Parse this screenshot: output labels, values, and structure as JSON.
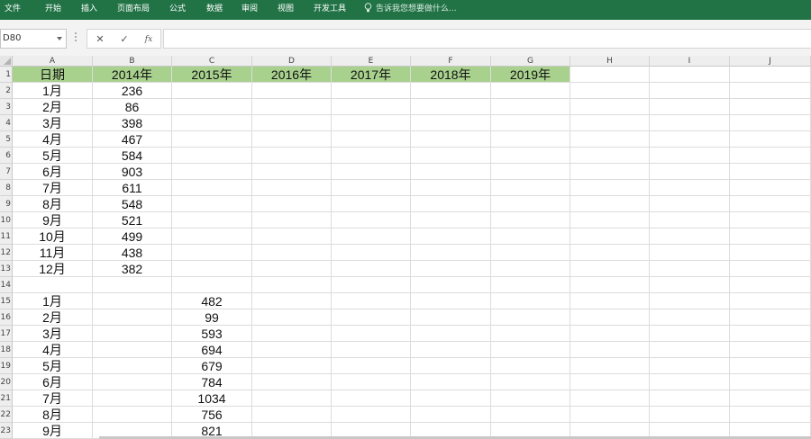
{
  "ribbon": {
    "tabs": [
      "文件",
      "开始",
      "插入",
      "页面布局",
      "公式",
      "数据",
      "审阅",
      "视图",
      "开发工具"
    ],
    "tell_me": "告诉我您想要做什么...",
    "color": "#217346"
  },
  "formula_bar": {
    "name_box": "D80",
    "cancel_icon": "✕",
    "enter_icon": "✓",
    "function_icon": "fx",
    "formula": ""
  },
  "sheet": {
    "columns": [
      "A",
      "B",
      "C",
      "D",
      "E",
      "F",
      "G",
      "H",
      "I",
      "J"
    ],
    "row_numbers": [
      "1",
      "2",
      "3",
      "4",
      "5",
      "6",
      "7",
      "8",
      "9",
      "10",
      "11",
      "12",
      "13",
      "14",
      "15",
      "16",
      "17",
      "18",
      "19",
      "20",
      "21",
      "22",
      "23"
    ],
    "header_fill": "#a9d18e",
    "rows": [
      [
        "日期",
        "2014年",
        "2015年",
        "2016年",
        "2017年",
        "2018年",
        "2019年",
        "",
        "",
        ""
      ],
      [
        "1月",
        "236",
        "",
        "",
        "",
        "",
        "",
        "",
        "",
        ""
      ],
      [
        "2月",
        "86",
        "",
        "",
        "",
        "",
        "",
        "",
        "",
        ""
      ],
      [
        "3月",
        "398",
        "",
        "",
        "",
        "",
        "",
        "",
        "",
        ""
      ],
      [
        "4月",
        "467",
        "",
        "",
        "",
        "",
        "",
        "",
        "",
        ""
      ],
      [
        "5月",
        "584",
        "",
        "",
        "",
        "",
        "",
        "",
        "",
        ""
      ],
      [
        "6月",
        "903",
        "",
        "",
        "",
        "",
        "",
        "",
        "",
        ""
      ],
      [
        "7月",
        "611",
        "",
        "",
        "",
        "",
        "",
        "",
        "",
        ""
      ],
      [
        "8月",
        "548",
        "",
        "",
        "",
        "",
        "",
        "",
        "",
        ""
      ],
      [
        "9月",
        "521",
        "",
        "",
        "",
        "",
        "",
        "",
        "",
        ""
      ],
      [
        "10月",
        "499",
        "",
        "",
        "",
        "",
        "",
        "",
        "",
        ""
      ],
      [
        "11月",
        "438",
        "",
        "",
        "",
        "",
        "",
        "",
        "",
        ""
      ],
      [
        "12月",
        "382",
        "",
        "",
        "",
        "",
        "",
        "",
        "",
        ""
      ],
      [
        "",
        "",
        "",
        "",
        "",
        "",
        "",
        "",
        "",
        ""
      ],
      [
        "1月",
        "",
        "482",
        "",
        "",
        "",
        "",
        "",
        "",
        ""
      ],
      [
        "2月",
        "",
        "99",
        "",
        "",
        "",
        "",
        "",
        "",
        ""
      ],
      [
        "3月",
        "",
        "593",
        "",
        "",
        "",
        "",
        "",
        "",
        ""
      ],
      [
        "4月",
        "",
        "694",
        "",
        "",
        "",
        "",
        "",
        "",
        ""
      ],
      [
        "5月",
        "",
        "679",
        "",
        "",
        "",
        "",
        "",
        "",
        ""
      ],
      [
        "6月",
        "",
        "784",
        "",
        "",
        "",
        "",
        "",
        "",
        ""
      ],
      [
        "7月",
        "",
        "1034",
        "",
        "",
        "",
        "",
        "",
        "",
        ""
      ],
      [
        "8月",
        "",
        "756",
        "",
        "",
        "",
        "",
        "",
        "",
        ""
      ],
      [
        "9月",
        "",
        "821",
        "",
        "",
        "",
        "",
        "",
        "",
        ""
      ]
    ]
  }
}
